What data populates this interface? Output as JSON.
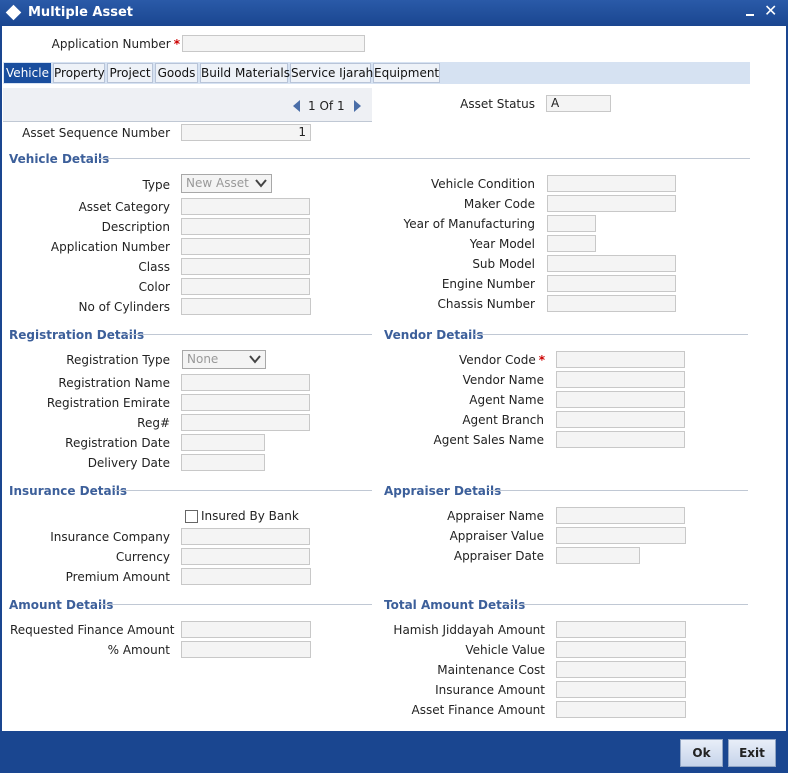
{
  "window": {
    "title": "Multiple Asset"
  },
  "header": {
    "application_number_label": "Application Number",
    "application_number_value": ""
  },
  "tabs": [
    "Vehicle",
    "Property",
    "Project",
    "Goods",
    "Build Materials",
    "Service Ijarah",
    "Equipment"
  ],
  "pager": {
    "current": "1",
    "of_label": "Of",
    "total": "1"
  },
  "asset_status": {
    "label": "Asset Status",
    "value": "A"
  },
  "asset_sequence": {
    "label": "Asset Sequence Number",
    "value": "1"
  },
  "vehicle_details": {
    "title": "Vehicle Details",
    "type_label": "Type",
    "type_value": "New Asset",
    "asset_category": "Asset Category",
    "description": "Description",
    "application_number": "Application Number",
    "class": "Class",
    "color": "Color",
    "cylinders": "No of Cylinders",
    "vehicle_condition": "Vehicle Condition",
    "maker_code": "Maker Code",
    "year_of_manufacturing": "Year of Manufacturing",
    "year_model": "Year Model",
    "sub_model": "Sub Model",
    "engine_number": "Engine Number",
    "chassis_number": "Chassis Number"
  },
  "registration_details": {
    "title": "Registration Details",
    "type_label": "Registration Type",
    "type_value": "None",
    "name": "Registration Name",
    "emirate": "Registration Emirate",
    "reg": "Reg#",
    "date": "Registration Date",
    "delivery_date": "Delivery Date"
  },
  "vendor_details": {
    "title": "Vendor Details",
    "vendor_code": "Vendor Code",
    "vendor_name": "Vendor Name",
    "agent_name": "Agent Name",
    "agent_branch": "Agent Branch",
    "agent_sales_name": "Agent Sales Name"
  },
  "insurance_details": {
    "title": "Insurance Details",
    "insured_by_bank": "Insured By Bank",
    "company": "Insurance Company",
    "currency": "Currency",
    "premium": "Premium Amount"
  },
  "appraiser_details": {
    "title": "Appraiser Details",
    "name": "Appraiser Name",
    "value": "Appraiser Value",
    "date": "Appraiser Date"
  },
  "amount_details": {
    "title": "Amount Details",
    "requested": "Requested Finance Amount",
    "percent": "% Amount"
  },
  "total_amount_details": {
    "title": "Total Amount Details",
    "hamish": "Hamish Jiddayah Amount",
    "vehicle_value": "Vehicle Value",
    "maintenance": "Maintenance Cost",
    "insurance": "Insurance Amount",
    "asset_finance": "Asset Finance Amount"
  },
  "footer": {
    "ok": "Ok",
    "exit": "Exit"
  }
}
